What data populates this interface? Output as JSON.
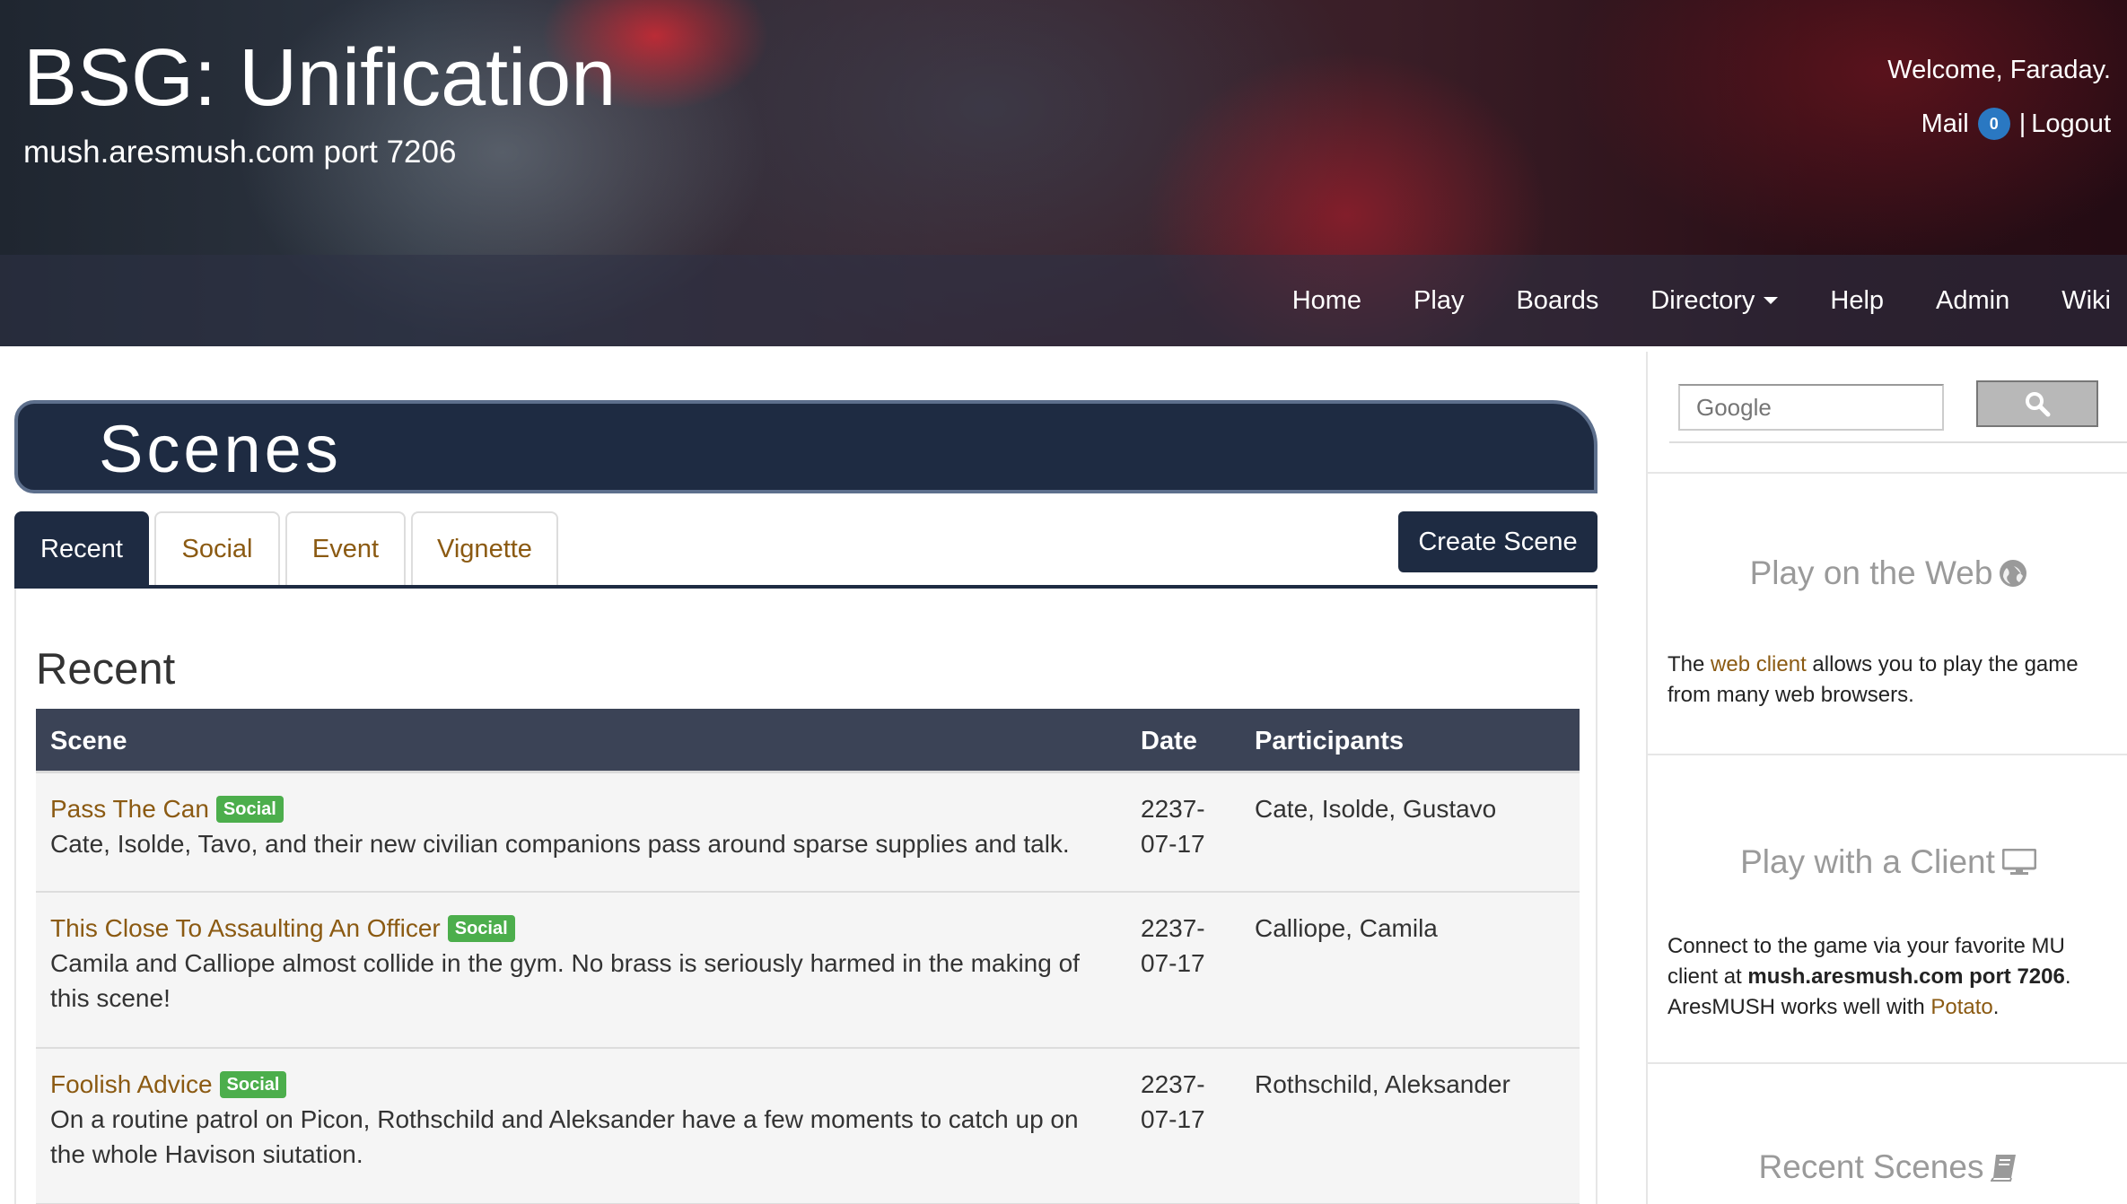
{
  "header": {
    "title": "BSG: Unification",
    "subtitle": "mush.aresmush.com port 7206",
    "welcome": "Welcome, Faraday.",
    "mail_label": "Mail",
    "mail_count": "0",
    "separator": "|",
    "logout_label": "Logout"
  },
  "nav": {
    "items": [
      "Home",
      "Play",
      "Boards",
      "Directory",
      "Help",
      "Admin",
      "Wiki"
    ]
  },
  "page": {
    "banner_title": "Scenes",
    "tabs": [
      "Recent",
      "Social",
      "Event",
      "Vignette"
    ],
    "active_tab": "Recent",
    "create_button": "Create Scene",
    "section_heading": "Recent"
  },
  "table": {
    "headers": [
      "Scene",
      "Date",
      "Participants"
    ],
    "rows": [
      {
        "title": "Pass The Can",
        "badge": "Social",
        "summary": "Cate, Isolde, Tavo, and their new civilian companions pass around sparse supplies and talk.",
        "date": "2237-07-17",
        "date_line1": "2237-",
        "date_line2": "07-17",
        "participants": "Cate, Isolde, Gustavo"
      },
      {
        "title": "This Close To Assaulting An Officer",
        "badge": "Social",
        "summary": "Camila and Calliope almost collide in the gym. No brass is seriously harmed in the making of this scene!",
        "date": "2237-07-17",
        "date_line1": "2237-",
        "date_line2": "07-17",
        "participants": "Calliope, Camila"
      },
      {
        "title": "Foolish Advice",
        "badge": "Social",
        "summary": "On a routine patrol on Picon, Rothschild and Aleksander have a few moments to catch up on the whole Havison siutation.",
        "date": "2237-07-17",
        "date_line1": "2237-",
        "date_line2": "07-17",
        "participants": "Rothschild, Aleksander"
      }
    ]
  },
  "sidebar": {
    "search_placeholder": "Google",
    "play_web": {
      "heading": "Play on the Web",
      "text_before": "The ",
      "link": "web client",
      "text_after": " allows you to play the game from many web browsers."
    },
    "play_client": {
      "heading": "Play with a Client",
      "text_before": "Connect to the game via your favorite MU client at ",
      "address": "mush.aresmush.com port 7206",
      "text_mid": ". AresMUSH works well with ",
      "link": "Potato",
      "text_after": "."
    },
    "recent_scenes": {
      "heading": "Recent Scenes"
    }
  },
  "colors": {
    "navy": "#1e2b42",
    "link_brown": "#8b5a12",
    "badge_green": "#4cae4c",
    "mail_badge_blue": "#2a78c2",
    "table_header": "#3b4356"
  },
  "icons": [
    "caret-down-icon",
    "search-icon",
    "globe-icon",
    "monitor-icon",
    "book-icon"
  ]
}
